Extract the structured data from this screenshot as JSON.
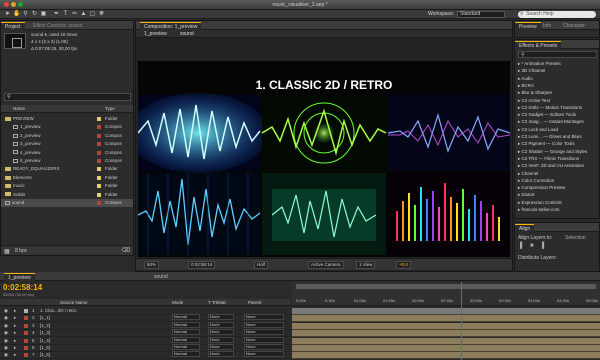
{
  "window": {
    "title": "music_visualiser_3.aep *"
  },
  "workspace": {
    "label": "Workspace:",
    "value": "Standard"
  },
  "search": {
    "placeholder": "Search Help"
  },
  "project": {
    "tab": "Project",
    "tab2": "Effect Controls: sound",
    "selected_name": "sound ▾, used 19 times",
    "info1": "4 x 4  (2 x 2) (1.00)",
    "info2": "Δ 0:07:05:25, 30,00 fps",
    "col_name": "Name",
    "col_type": "Type",
    "items": [
      {
        "name": "PREVIEW",
        "type": "Folder",
        "kind": "folder",
        "indent": 0,
        "label_color": "#e0d060"
      },
      {
        "name": "1_preview",
        "type": "Compos",
        "kind": "comp",
        "indent": 1,
        "label_color": "#c04040"
      },
      {
        "name": "2_preview",
        "type": "Compos",
        "kind": "comp",
        "indent": 1,
        "label_color": "#c04040"
      },
      {
        "name": "3_preview",
        "type": "Compos",
        "kind": "comp",
        "indent": 1,
        "label_color": "#c04040"
      },
      {
        "name": "4_preview",
        "type": "Compos",
        "kind": "comp",
        "indent": 1,
        "label_color": "#c04040"
      },
      {
        "name": "5_preview",
        "type": "Compos",
        "kind": "comp",
        "indent": 1,
        "label_color": "#c04040"
      },
      {
        "name": "READY_EQUALIZERS",
        "type": "Folder",
        "kind": "folder",
        "indent": 0,
        "label_color": "#e0d060"
      },
      {
        "name": "Elements",
        "type": "Folder",
        "kind": "folder",
        "indent": 0,
        "label_color": "#e0d060"
      },
      {
        "name": "music",
        "type": "Folder",
        "kind": "folder",
        "indent": 0,
        "label_color": "#e0d060"
      },
      {
        "name": "Solids",
        "type": "Folder",
        "kind": "folder",
        "indent": 0,
        "label_color": "#e0d060"
      },
      {
        "name": "sound",
        "type": "Compos",
        "kind": "comp",
        "indent": 0,
        "label_color": "#c04040",
        "selected": true
      }
    ],
    "footer_bpc": "8 bpc"
  },
  "composition": {
    "tab": "Composition: 1_preview",
    "crumb1": "1_preview",
    "crumb2": "sound",
    "headline": "1. CLASSIC 2D / RETRO",
    "zoom": "50%",
    "timecode": "0:02:58:14",
    "resolution": "Half",
    "camera": "Active Camera",
    "views": "1 View",
    "exposure": "+0.0"
  },
  "preview_panel": {
    "tab": "Preview",
    "tab2": "Info",
    "tab3": "Character"
  },
  "effects": {
    "tab": "Effects & Presets",
    "items": [
      "* Animation Presets",
      "3D Channel",
      "Audio",
      "BCRA",
      "Blur & Sharpen",
      "C2 Active Text",
      "C2 Dolls — Motion Transitions",
      "C2 Gadget — Editors Tools",
      "C2 Imag... — Instant Montages",
      "C2 Lock and Load",
      "C2 Lumi... — Glows and Blurs",
      "C2 Pigment — Color Tools",
      "C2 Shatter — Grunge and Styles",
      "C2 TRX — Filmic Transitions",
      "C2 VenF. 2D and VU Animation",
      "Channel",
      "Color Correction",
      "Compression Preview",
      "Distort",
      "Expression Controls",
      "francois-tarlier.com"
    ]
  },
  "align": {
    "tab": "Align",
    "align_to": "Align Layers to:",
    "align_to_value": "Selection",
    "distribute": "Distribute Layers:"
  },
  "timeline": {
    "tab1": "1_preview",
    "tab2": "sound",
    "timecode": "0:02:58:14",
    "fps": "05354 (30.00 fps)",
    "col_source": "Source Name",
    "col_mode": "Mode",
    "col_trkmat": "T TrkMat",
    "col_parent": "Parent",
    "ruler": [
      "0:00s",
      "0:30s",
      "01:00s",
      "01:30s",
      "02:00s",
      "02:30s",
      "03:00s",
      "03:30s",
      "04:00s",
      "04:30s",
      "05:00s"
    ],
    "layers": [
      {
        "num": "1",
        "name": "1. Clas...2D / retro",
        "mode": "",
        "trkmat": "",
        "parent": ""
      },
      {
        "num": "2",
        "name": "[1_1]",
        "mode": "Normal",
        "trkmat": "None",
        "parent": "None"
      },
      {
        "num": "3",
        "name": "[1_2]",
        "mode": "Normal",
        "trkmat": "None",
        "parent": "None"
      },
      {
        "num": "4",
        "name": "[1_3]",
        "mode": "Normal",
        "trkmat": "None",
        "parent": "None"
      },
      {
        "num": "5",
        "name": "[1_4]",
        "mode": "Normal",
        "trkmat": "None",
        "parent": "None"
      },
      {
        "num": "6",
        "name": "[1_5]",
        "mode": "Normal",
        "trkmat": "None",
        "parent": "None"
      },
      {
        "num": "7",
        "name": "[1_6]",
        "mode": "Normal",
        "trkmat": "None",
        "parent": "None"
      }
    ],
    "playhead_fraction": 0.55
  },
  "colors": {
    "accent": "#ffb400",
    "playhead": "#ee3333",
    "bar": "#8c7d5f"
  },
  "icons": [
    "arrow-icon",
    "hand-icon",
    "zoom-icon",
    "rotate-icon",
    "camera-icon",
    "pen-icon",
    "text-icon",
    "brush-icon",
    "stamp-icon",
    "eraser-icon",
    "puppet-icon"
  ]
}
